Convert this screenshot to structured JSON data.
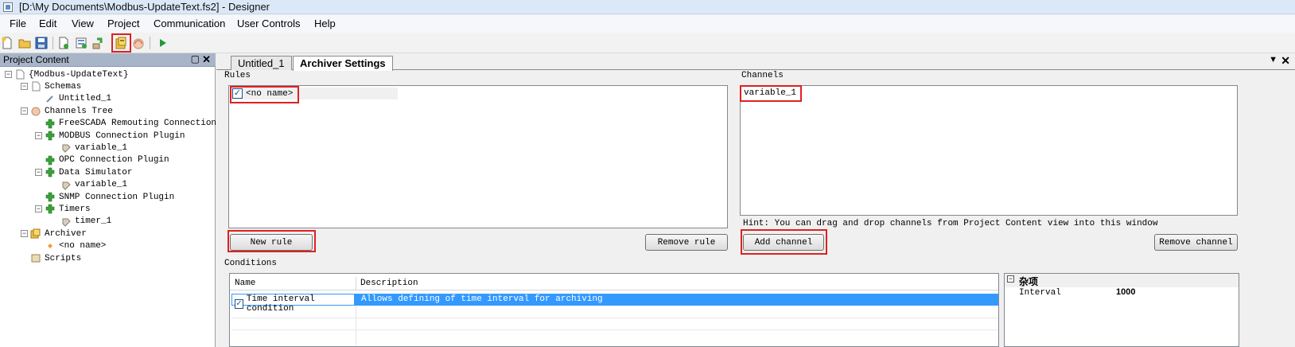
{
  "window": {
    "title": "[D:\\My Documents\\Modbus-UpdateText.fs2] - Designer"
  },
  "menu": [
    "File",
    "Edit",
    "View",
    "Project",
    "Communication",
    "User Controls",
    "Help"
  ],
  "toolbar": {
    "buttons": [
      "new-file-icon",
      "open-folder-icon",
      "save-icon",
      "add-schema-icon",
      "add-document-icon",
      "channel-plugin-icon",
      "archiver-icon",
      "channels-icon",
      "run-icon"
    ]
  },
  "left_panel": {
    "title": "Project Content",
    "pin": "▢",
    "close": "✕",
    "tree": [
      {
        "label": "{Modbus-UpdateText}",
        "level": 0
      },
      {
        "label": "Schemas",
        "level": 1
      },
      {
        "label": "Untitled_1",
        "level": 2
      },
      {
        "label": "Channels Tree",
        "level": 1
      },
      {
        "label": "FreeSCADA Remouting Connection Pl",
        "level": 2
      },
      {
        "label": "MODBUS Connection Plugin",
        "level": 2
      },
      {
        "label": "variable_1",
        "level": 3
      },
      {
        "label": "OPC Connection Plugin",
        "level": 2
      },
      {
        "label": "Data Simulator",
        "level": 2
      },
      {
        "label": "variable_1",
        "level": 3
      },
      {
        "label": "SNMP Connection Plugin",
        "level": 2
      },
      {
        "label": "Timers",
        "level": 2
      },
      {
        "label": "timer_1",
        "level": 3
      },
      {
        "label": "Archiver",
        "level": 1
      },
      {
        "label": "<no name>",
        "level": 2
      },
      {
        "label": "Scripts",
        "level": 1
      }
    ]
  },
  "tabs": [
    {
      "label": "Untitled_1",
      "active": false
    },
    {
      "label": "Archiver Settings",
      "active": true
    }
  ],
  "rules": {
    "label": "Rules",
    "items": [
      {
        "label": "<no name>",
        "checked": true
      }
    ],
    "new_button": "New rule",
    "remove_button": "Remove rule"
  },
  "channels": {
    "label": "Channels",
    "items": [
      "variable_1"
    ],
    "hint": "Hint: You can drag and drop channels from Project Content view into this window",
    "add_button": "Add channel",
    "remove_button": "Remove channel"
  },
  "conditions": {
    "label": "Conditions",
    "columns": [
      "Name",
      "Description"
    ],
    "rows": [
      {
        "name": "Time interval condition",
        "description": "Allows defining of time interval for archiving",
        "checked": true
      }
    ]
  },
  "properties": {
    "category": "杂项",
    "rows": [
      {
        "name": "Interval",
        "value": "1000"
      }
    ]
  },
  "colors": {
    "accent_red": "#e02020",
    "selection_blue": "#3399ff",
    "panel_header": "#a8b5c8"
  }
}
